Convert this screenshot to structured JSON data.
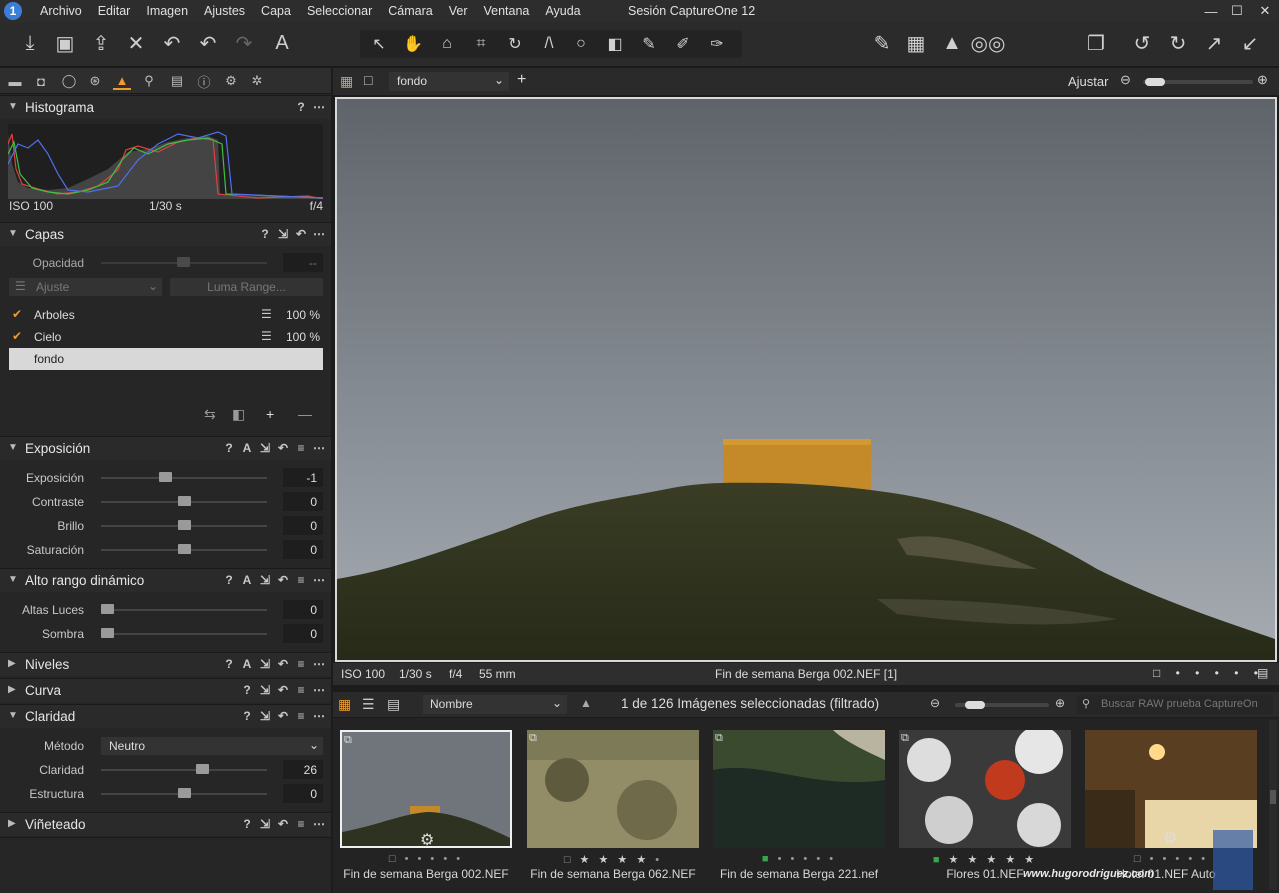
{
  "menu": [
    "Archivo",
    "Editar",
    "Imagen",
    "Ajustes",
    "Capa",
    "Seleccionar",
    "Cámara",
    "Ver",
    "Ventana",
    "Ayuda"
  ],
  "session_title": "Sesión CaptureOne 12",
  "histogram": {
    "title": "Histograma",
    "iso": "ISO 100",
    "shutter": "1/30 s",
    "aperture": "f/4"
  },
  "layers": {
    "title": "Capas",
    "opacity_label": "Opacidad",
    "opacity_value": "--",
    "adjust_label": "Ajuste",
    "luma_label": "Luma Range...",
    "items": [
      {
        "name": "Arboles",
        "value": "100 %",
        "checked": true
      },
      {
        "name": "Cielo",
        "value": "100 %",
        "checked": true
      },
      {
        "name": "fondo",
        "value": "",
        "checked": false
      }
    ]
  },
  "exposure": {
    "title": "Exposición",
    "rows": [
      {
        "label": "Exposición",
        "value": "-1",
        "pos": 0.38
      },
      {
        "label": "Contraste",
        "value": "0",
        "pos": 0.5
      },
      {
        "label": "Brillo",
        "value": "0",
        "pos": 0.5
      },
      {
        "label": "Saturación",
        "value": "0",
        "pos": 0.5
      }
    ]
  },
  "hdr": {
    "title": "Alto rango dinámico",
    "rows": [
      {
        "label": "Altas Luces",
        "value": "0",
        "pos": 0.0
      },
      {
        "label": "Sombra",
        "value": "0",
        "pos": 0.0
      }
    ]
  },
  "levels_title": "Niveles",
  "curve_title": "Curva",
  "clarity": {
    "title": "Claridad",
    "method_label": "Método",
    "method_value": "Neutro",
    "rows": [
      {
        "label": "Claridad",
        "value": "26",
        "pos": 0.62
      },
      {
        "label": "Estructura",
        "value": "0",
        "pos": 0.5
      }
    ]
  },
  "vignette_title": "Viñeteado",
  "viewer": {
    "layer_select": "fondo",
    "adjust_label": "Ajustar",
    "iso": "ISO 100",
    "shutter": "1/30 s",
    "aperture": "f/4",
    "focal": "55 mm",
    "filename": "Fin de semana Berga 002.NEF [1]"
  },
  "browser": {
    "sort": "Nombre",
    "count": "1 de 126 Imágenes seleccionadas (filtrado)",
    "search_placeholder": "Buscar RAW prueba CaptureOn"
  },
  "thumbs": [
    {
      "name": "Fin de semana Berga 002.NEF",
      "rating": "□ • • • • •",
      "stars": 0
    },
    {
      "name": "Fin de semana Berga 062.NEF",
      "rating": "□ ★ ★ ★ ★ •",
      "stars": 4
    },
    {
      "name": "Fin de semana Berga 221.nef",
      "rating": "■ • • • • •",
      "stars": 0
    },
    {
      "name": "Flores 01.NEF",
      "rating": "■ ★ ★ ★ ★ ★",
      "stars": 5
    },
    {
      "name": "Hotel 01.NEF Auto",
      "rating": "□ • • • • •",
      "stars": 0
    }
  ],
  "watermark": "www.hugorodriguez.com"
}
